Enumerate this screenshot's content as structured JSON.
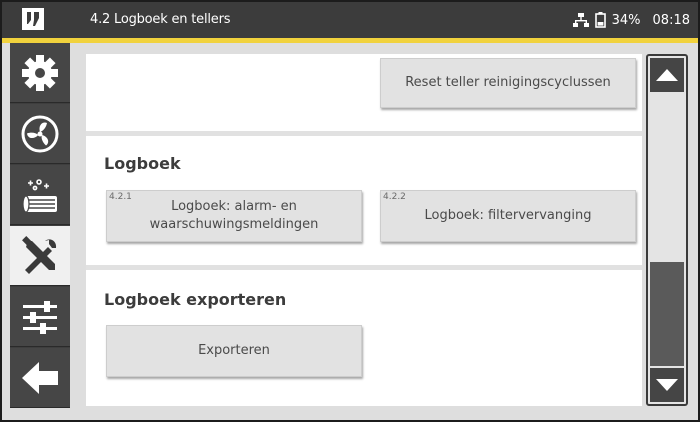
{
  "header": {
    "title": "4.2 Logboek en tellers",
    "battery": "34%",
    "time": "08:18",
    "icons": [
      "logo-icon",
      "network-icon",
      "battery-icon"
    ]
  },
  "sidebar": {
    "items": [
      {
        "icon": "gear-icon",
        "active": false
      },
      {
        "icon": "fan-icon",
        "active": false
      },
      {
        "icon": "filter-cleaning-icon",
        "active": false
      },
      {
        "icon": "tools-icon",
        "active": true
      },
      {
        "icon": "sliders-icon",
        "active": false
      },
      {
        "icon": "back-arrow-icon",
        "active": false
      }
    ]
  },
  "main": {
    "reset_button": "Reset teller reinigingscyclussen",
    "logbook": {
      "title": "Logboek",
      "buttons": [
        {
          "number": "4.2.1",
          "label": "Logboek: alarm- en waarschuwingsmeldingen"
        },
        {
          "number": "4.2.2",
          "label": "Logboek: filtervervanging"
        }
      ]
    },
    "export": {
      "title": "Logboek exporteren",
      "button": "Exporteren"
    }
  },
  "scrollbar": {
    "up_icon": "triangle-up-icon",
    "down_icon": "triangle-down-icon"
  },
  "colors": {
    "topbar": "#3c3c3c",
    "accent": "#f1d23d",
    "sidebar": "#464646",
    "button": "#e2e2e2",
    "background": "#dedede"
  }
}
